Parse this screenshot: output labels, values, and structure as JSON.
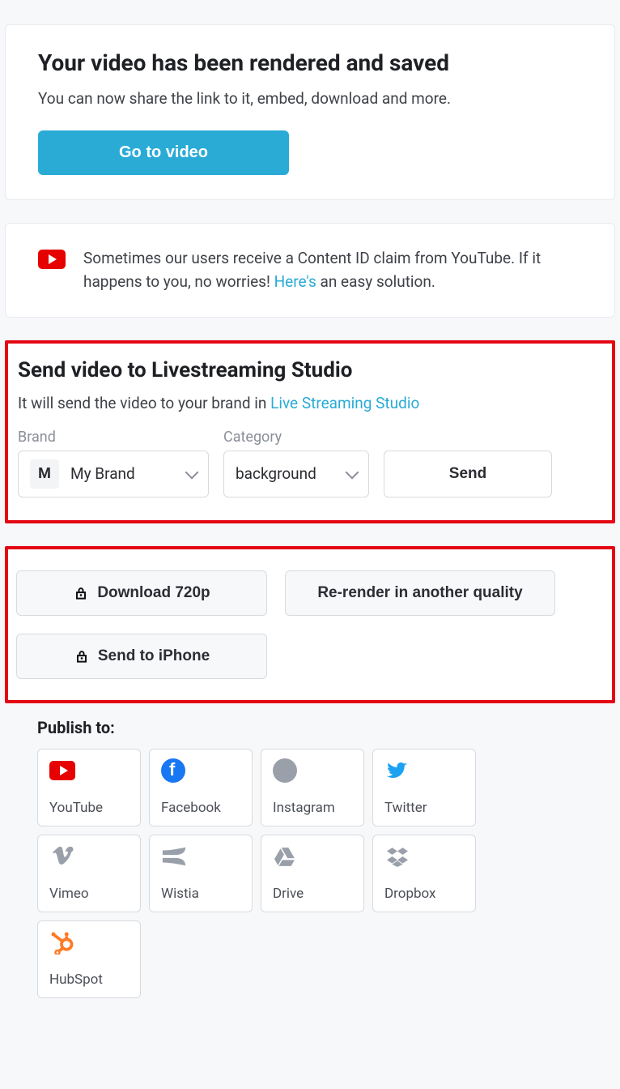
{
  "rendered": {
    "title": "Your video has been rendered and saved",
    "subtext": "You can now share the link to it, embed, download and more.",
    "go_button": "Go to video"
  },
  "notice": {
    "text_before": "Sometimes our users receive a Content ID claim from YouTube. If it happens to you, no worries! ",
    "link_text": "Here's",
    "text_after": " an easy solution."
  },
  "livestream": {
    "title": "Send video to Livestreaming Studio",
    "sub_before": "It will send the video to your brand in ",
    "sub_link": "Live Streaming Studio",
    "brand_label": "Brand",
    "brand_chip": "M",
    "brand_value": "My Brand",
    "category_label": "Category",
    "category_value": "background",
    "send_label": "Send"
  },
  "actions": {
    "download": "Download 720p",
    "rerender": "Re-render in another quality",
    "send_iphone": "Send to iPhone"
  },
  "publish": {
    "title": "Publish to:",
    "targets": [
      {
        "key": "youtube",
        "label": "YouTube"
      },
      {
        "key": "facebook",
        "label": "Facebook"
      },
      {
        "key": "instagram",
        "label": "Instagram"
      },
      {
        "key": "twitter",
        "label": "Twitter"
      },
      {
        "key": "vimeo",
        "label": "Vimeo"
      },
      {
        "key": "wistia",
        "label": "Wistia"
      },
      {
        "key": "drive",
        "label": "Drive"
      },
      {
        "key": "dropbox",
        "label": "Dropbox"
      },
      {
        "key": "hubspot",
        "label": "HubSpot"
      }
    ]
  }
}
